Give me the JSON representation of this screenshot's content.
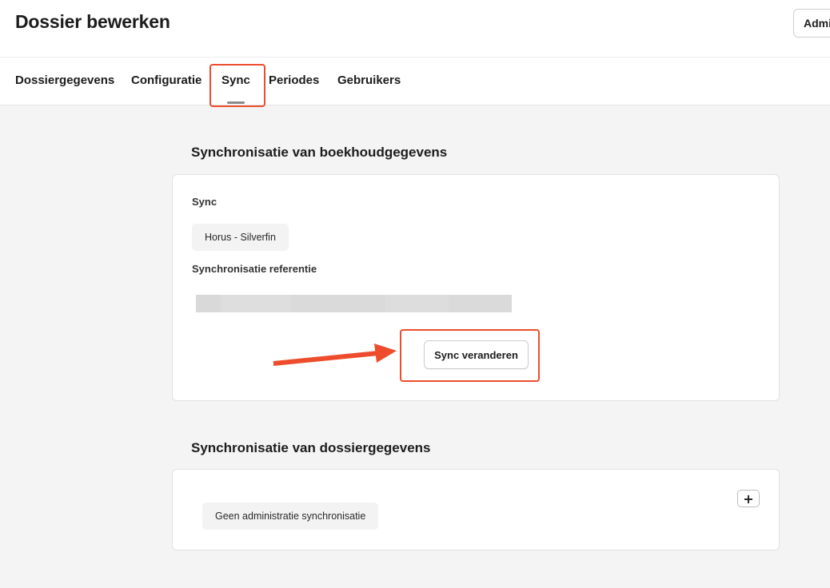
{
  "header": {
    "title": "Dossier bewerken",
    "admin_label": "Admi"
  },
  "tabs": [
    {
      "label": "Dossiergegevens",
      "active": false
    },
    {
      "label": "Configuratie",
      "active": false
    },
    {
      "label": "Sync",
      "active": true
    },
    {
      "label": "Periodes",
      "active": false
    },
    {
      "label": "Gebruikers",
      "active": false
    }
  ],
  "accounting_sync": {
    "title": "Synchronisatie van boekhoudgegevens",
    "sync_label": "Sync",
    "sync_value": "Horus - Silverfin",
    "reference_label": "Synchronisatie referentie",
    "change_button": "Sync veranderen"
  },
  "dossier_sync": {
    "title": "Synchronisatie van dossiergegevens",
    "add_button": "+",
    "empty_text": "Geen administratie synchronisatie"
  },
  "colors": {
    "annotation": "#ee4d2d",
    "background": "#f4f4f4",
    "card": "#ffffff"
  }
}
